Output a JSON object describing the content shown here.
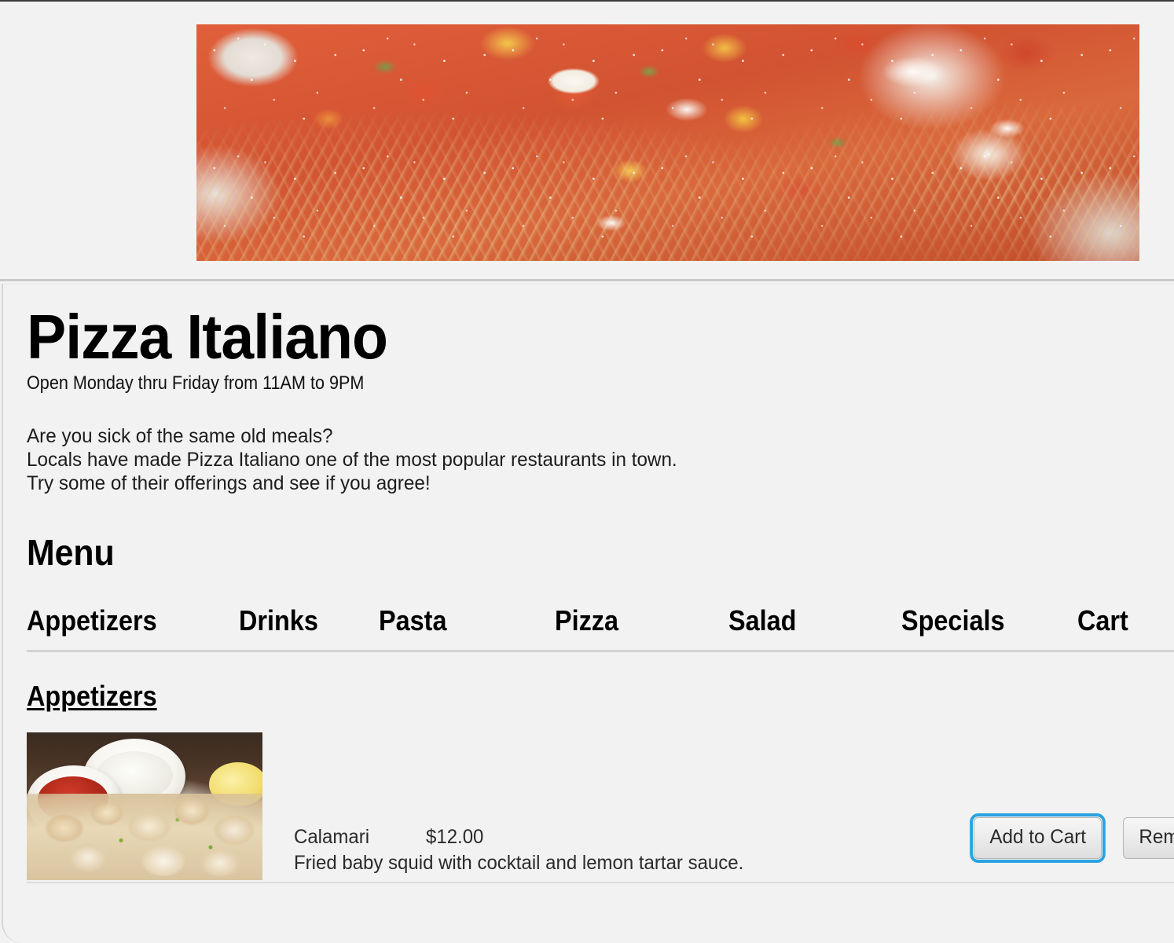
{
  "hero": {
    "image_alt": "spaghetti-with-tomato-sauce-and-parmesan-photo"
  },
  "restaurant": {
    "name": "Pizza Italiano",
    "hours": "Open Monday thru Friday from 11AM to 9PM",
    "blurb_line_1": "Are you sick of the same old meals?",
    "blurb_line_2": "Locals have made Pizza Italiano one of the most popular restaurants in town.",
    "blurb_line_3": "Try some of their offerings and see if you agree!"
  },
  "menu": {
    "heading": "Menu",
    "tabs": [
      {
        "label": "Appetizers"
      },
      {
        "label": "Drinks"
      },
      {
        "label": "Pasta"
      },
      {
        "label": "Pizza"
      },
      {
        "label": "Salad"
      },
      {
        "label": "Specials"
      },
      {
        "label": "Cart"
      }
    ],
    "active_section": "Appetizers",
    "items": [
      {
        "name": "Calamari",
        "price": "$12.00",
        "description": "Fried baby squid with cocktail and lemon tartar sauce.",
        "image_alt": "fried-calamari-with-dipping-sauces-photo",
        "add_label": "Add to Cart",
        "remove_label": "Remove from Cart"
      }
    ]
  },
  "colors": {
    "page_background": "#f2f2f2",
    "text": "#000000",
    "focus_ring": "#2aa3e0",
    "divider": "#d2d2d2",
    "button_face": "#ececec"
  }
}
